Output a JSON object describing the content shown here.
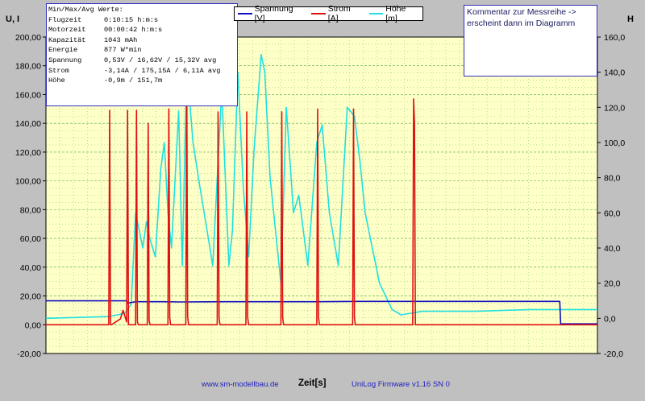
{
  "info": {
    "heading": "Min/Max/Avg Werte:",
    "rows": [
      {
        "key": "Flugzeit",
        "value": "0:10:15 h:m:s"
      },
      {
        "key": "Motorzeit",
        "value": "00:00:42 h:m:s"
      },
      {
        "key": "Kapazität",
        "value": "1043 mAh"
      },
      {
        "key": "Energie",
        "value": "877 W*min"
      },
      {
        "key": "Spannung",
        "value": "0,53V / 16,62V / 15,32V avg"
      },
      {
        "key": "Strom",
        "value": "-3,14A / 175,15A / 6,11A avg"
      },
      {
        "key": "Höhe",
        "value": "-0,9m / 151,7m"
      }
    ]
  },
  "comment": {
    "line1": "Kommentar zur Messreihe ->",
    "line2": "erscheint dann im Diagramm"
  },
  "footer": {
    "url": "www.sm-modellbau.de",
    "xlabel": "Zeit[s]",
    "firmware": "UniLog Firmware v1.16 SN 0"
  },
  "colors": {
    "plot_bg": "#ffffc8",
    "grid": "#30a030",
    "voltage": "#1010c0",
    "current": "#e01010",
    "height": "#20e0e0"
  },
  "chart_data": {
    "type": "line",
    "xlabel": "Zeit[s]",
    "ylabel_left": "U, I",
    "ylabel_right": "H",
    "ylim_left": [
      -20,
      200
    ],
    "ylim_right": [
      -20,
      160
    ],
    "yticks_left": [
      "200,00",
      "180,00",
      "160,00",
      "140,00",
      "120,00",
      "100,00",
      "80,00",
      "60,00",
      "40,00",
      "20,00",
      "0,00",
      "-20,00"
    ],
    "yticks_right": [
      "160,0",
      "140,0",
      "120,0",
      "100,0",
      "80,0",
      "60,0",
      "40,0",
      "20,0",
      "0,0",
      "-20,0"
    ],
    "x_range": [
      0,
      615
    ],
    "grid": true,
    "legend_position": "top",
    "series": [
      {
        "name": "Spannung [V]",
        "axis": "left",
        "color": "#1010c0",
        "x": [
          0,
          60,
          90,
          91,
          100,
          130,
          150,
          200,
          250,
          300,
          350,
          400,
          450,
          500,
          550,
          573,
          574,
          615
        ],
        "y": [
          16.6,
          16.6,
          16.6,
          15.0,
          16.0,
          16.0,
          15.8,
          16.0,
          16.0,
          16.0,
          16.2,
          16.2,
          16.2,
          16.2,
          16.2,
          16.2,
          0.6,
          0.6
        ]
      },
      {
        "name": "Strom [A]",
        "axis": "left",
        "color": "#e01010",
        "x": [
          0,
          70,
          71,
          72,
          73,
          83,
          86,
          90,
          91,
          92,
          93,
          100,
          101,
          102,
          103,
          113,
          114,
          115,
          116,
          136,
          137,
          138,
          139,
          156,
          157,
          158,
          159,
          191,
          192,
          193,
          194,
          223,
          224,
          225,
          226,
          262,
          263,
          264,
          265,
          302,
          303,
          304,
          305,
          342,
          343,
          344,
          345,
          409,
          410,
          411,
          412,
          615
        ],
        "y": [
          0,
          0,
          149,
          0,
          0,
          4,
          10,
          2,
          149,
          0,
          0,
          0,
          149,
          2,
          0,
          0,
          140,
          3,
          0,
          0,
          150,
          5,
          0,
          0,
          175,
          6,
          0,
          0,
          148,
          5,
          0,
          0,
          148,
          5,
          0,
          0,
          148,
          5,
          0,
          0,
          150,
          5,
          0,
          0,
          150,
          5,
          0,
          0,
          157,
          140,
          0,
          0
        ]
      },
      {
        "name": "Höhe [m]",
        "axis": "right",
        "color": "#20e0e0",
        "x": [
          0,
          70,
          80,
          88,
          95,
          100,
          104,
          108,
          112,
          116,
          122,
          128,
          132,
          136,
          140,
          148,
          152,
          156,
          160,
          164,
          170,
          178,
          186,
          196,
          204,
          208,
          214,
          220,
          226,
          232,
          240,
          244,
          250,
          262,
          268,
          276,
          282,
          292,
          302,
          308,
          316,
          326,
          336,
          344,
          350,
          356,
          372,
          386,
          396,
          420,
          480,
          540,
          615
        ],
        "y": [
          0,
          1,
          2,
          3,
          8,
          60,
          50,
          40,
          55,
          45,
          35,
          85,
          100,
          60,
          40,
          118,
          30,
          120,
          125,
          100,
          80,
          55,
          30,
          130,
          30,
          50,
          140,
          75,
          35,
          95,
          150,
          140,
          80,
          20,
          120,
          60,
          70,
          30,
          100,
          110,
          60,
          30,
          120,
          115,
          90,
          60,
          20,
          5,
          2,
          4,
          4,
          5,
          5
        ]
      }
    ]
  }
}
